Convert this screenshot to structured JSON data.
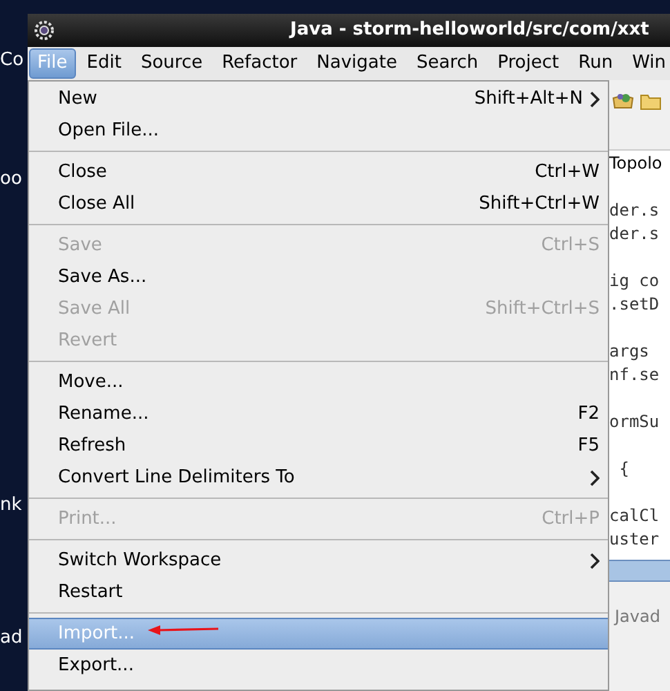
{
  "desktop": {
    "labels": [
      "Co",
      "oo",
      "nk",
      "ad"
    ]
  },
  "window": {
    "title": "Java - storm-helloworld/src/com/xxt"
  },
  "menubar": [
    {
      "label": "File",
      "selected": true
    },
    {
      "label": "Edit",
      "selected": false
    },
    {
      "label": "Source",
      "selected": false
    },
    {
      "label": "Refactor",
      "selected": false
    },
    {
      "label": "Navigate",
      "selected": false
    },
    {
      "label": "Search",
      "selected": false
    },
    {
      "label": "Project",
      "selected": false
    },
    {
      "label": "Run",
      "selected": false
    },
    {
      "label": "Win",
      "selected": false
    }
  ],
  "file_menu": [
    {
      "kind": "item",
      "label": "New",
      "shortcut": "Shift+Alt+N",
      "submenu": true,
      "disabled": false,
      "selected": false
    },
    {
      "kind": "item",
      "label": "Open File...",
      "submenu": false,
      "disabled": false,
      "selected": false
    },
    {
      "kind": "separator"
    },
    {
      "kind": "item",
      "label": "Close",
      "shortcut": "Ctrl+W",
      "submenu": false,
      "disabled": false,
      "selected": false
    },
    {
      "kind": "item",
      "label": "Close All",
      "shortcut": "Shift+Ctrl+W",
      "submenu": false,
      "disabled": false,
      "selected": false
    },
    {
      "kind": "separator"
    },
    {
      "kind": "item",
      "label": "Save",
      "shortcut": "Ctrl+S",
      "submenu": false,
      "disabled": true,
      "selected": false
    },
    {
      "kind": "item",
      "label": "Save As...",
      "submenu": false,
      "disabled": false,
      "selected": false
    },
    {
      "kind": "item",
      "label": "Save All",
      "shortcut": "Shift+Ctrl+S",
      "submenu": false,
      "disabled": true,
      "selected": false
    },
    {
      "kind": "item",
      "label": "Revert",
      "submenu": false,
      "disabled": true,
      "selected": false
    },
    {
      "kind": "separator"
    },
    {
      "kind": "item",
      "label": "Move...",
      "submenu": false,
      "disabled": false,
      "selected": false
    },
    {
      "kind": "item",
      "label": "Rename...",
      "shortcut": "F2",
      "submenu": false,
      "disabled": false,
      "selected": false
    },
    {
      "kind": "item",
      "label": "Refresh",
      "shortcut": "F5",
      "submenu": false,
      "disabled": false,
      "selected": false
    },
    {
      "kind": "item",
      "label": "Convert Line Delimiters To",
      "submenu": true,
      "disabled": false,
      "selected": false
    },
    {
      "kind": "separator"
    },
    {
      "kind": "item",
      "label": "Print...",
      "shortcut": "Ctrl+P",
      "submenu": false,
      "disabled": true,
      "selected": false
    },
    {
      "kind": "separator"
    },
    {
      "kind": "item",
      "label": "Switch Workspace",
      "submenu": true,
      "disabled": false,
      "selected": false
    },
    {
      "kind": "item",
      "label": "Restart",
      "submenu": false,
      "disabled": false,
      "selected": false
    },
    {
      "kind": "separator"
    },
    {
      "kind": "item",
      "label": "Import...",
      "submenu": false,
      "disabled": false,
      "selected": true,
      "marked": true
    },
    {
      "kind": "item",
      "label": "Export...",
      "submenu": false,
      "disabled": false,
      "selected": false
    }
  ],
  "editor": {
    "tab": "Topolo",
    "lines": [
      {
        "kind": "blank"
      },
      {
        "kind": "code",
        "text": "der.s"
      },
      {
        "kind": "code",
        "text": "der.s"
      },
      {
        "kind": "blank"
      },
      {
        "kind": "code",
        "text": "ig co"
      },
      {
        "kind": "code",
        "text": ".setD"
      },
      {
        "kind": "blank"
      },
      {
        "kind": "code",
        "text": "args"
      },
      {
        "kind": "code",
        "text": "nf.se"
      },
      {
        "kind": "blank"
      },
      {
        "kind": "code",
        "text": "ormSu"
      },
      {
        "kind": "blank"
      },
      {
        "kind": "code",
        "text": " {"
      },
      {
        "kind": "blank"
      },
      {
        "kind": "code",
        "text": "calCl"
      },
      {
        "kind": "code",
        "text": "uster"
      }
    ],
    "bottom_tab": "Javad"
  }
}
